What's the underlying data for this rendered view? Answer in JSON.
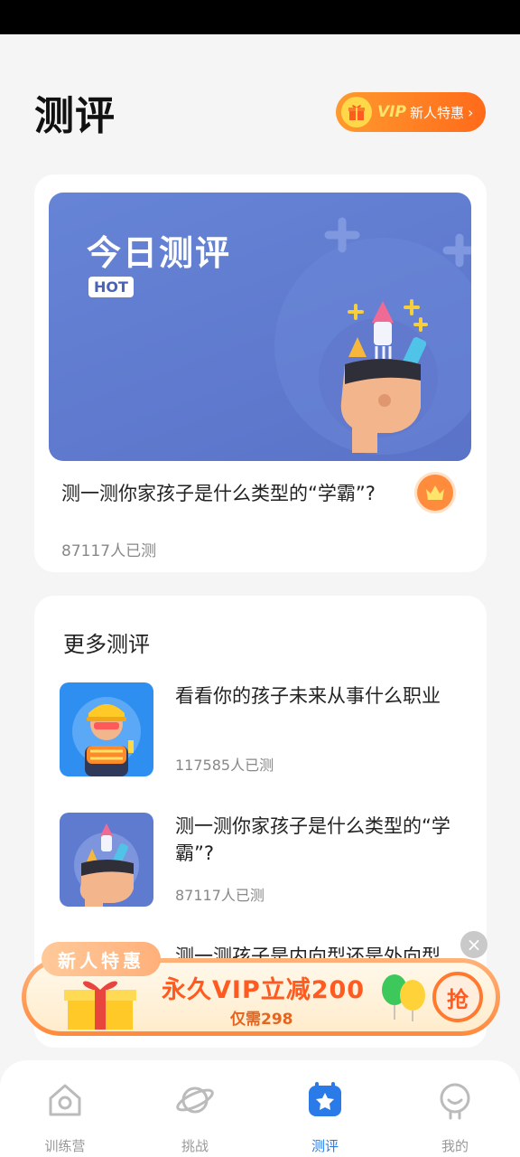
{
  "page": {
    "title": "测评"
  },
  "vip": {
    "badge": "VIP",
    "label": "新人特惠",
    "arrow": "›"
  },
  "today": {
    "title": "今日测评",
    "badge": "HOT",
    "description": "测一测你家孩子是什么类型的“学霸”?",
    "count": "87117人已测"
  },
  "more": {
    "title": "更多测评",
    "items": [
      {
        "title": "看看你的孩子未来从事什么职业",
        "count": "117585人已测"
      },
      {
        "title": "测一测你家孩子是什么类型的“学霸”?",
        "count": "87117人已测"
      },
      {
        "title": "测一测孩子是内向型还是外向型",
        "count": ""
      }
    ]
  },
  "promo": {
    "tag": "新人特惠",
    "main": "永久VIP立减200",
    "sub": "仅需298",
    "grab": "抢",
    "close": "×"
  },
  "tabs": [
    {
      "label": "训练营",
      "icon": "home-icon"
    },
    {
      "label": "挑战",
      "icon": "planet-icon"
    },
    {
      "label": "测评",
      "icon": "assessment-icon",
      "active": true
    },
    {
      "label": "我的",
      "icon": "profile-icon"
    }
  ],
  "colors": {
    "accent": "#2a7be8",
    "banner": "#5f7bd0",
    "promo": "#ff6a1a"
  }
}
